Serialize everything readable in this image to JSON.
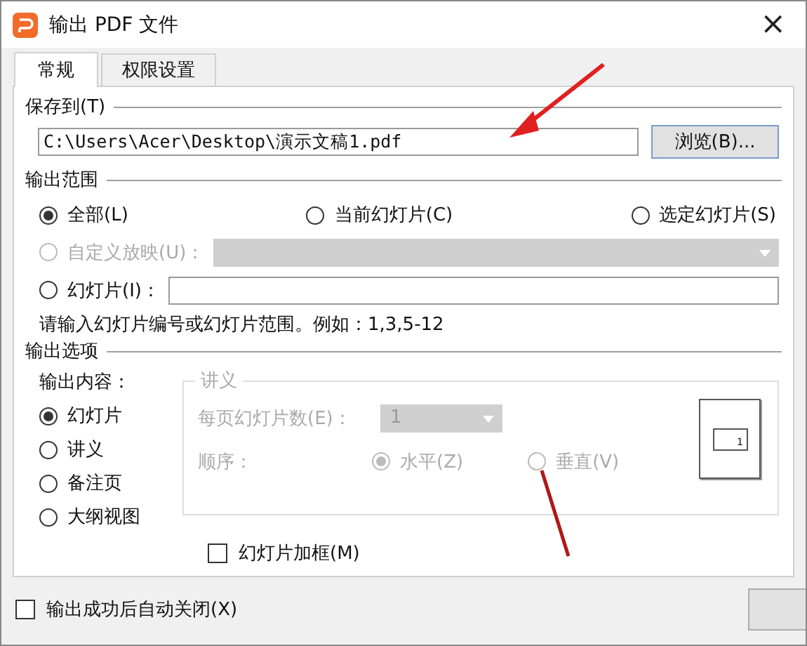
{
  "window": {
    "title": "输出 PDF 文件",
    "close": "×"
  },
  "tabs": [
    {
      "label": "常规",
      "selected": true
    },
    {
      "label": "权限设置",
      "selected": false
    }
  ],
  "save_to": {
    "heading": "保存到(T)",
    "path": "C:\\Users\\Acer\\Desktop\\演示文稿1.pdf",
    "browse_button": "浏览(B)..."
  },
  "output_range": {
    "heading": "输出范围",
    "options": [
      {
        "label": "全部(L)",
        "selected": true
      },
      {
        "label": "当前幻灯片(C)",
        "selected": false
      },
      {
        "label": "选定幻灯片(S)",
        "selected": false
      }
    ],
    "rows": [
      {
        "kind": "combo",
        "label": "自定义放映(U)：",
        "selected": false,
        "disabled": true
      },
      {
        "kind": "field",
        "label": "幻灯片(I)：",
        "selected": false,
        "disabled": false
      }
    ],
    "hint": "请输入幻灯片编号或幻灯片范围。例如：1,3,5-12"
  },
  "output_options": {
    "heading": "输出选项",
    "content_label": "输出内容：",
    "contents": [
      {
        "label": "幻灯片",
        "selected": true
      },
      {
        "label": "讲义",
        "selected": false
      },
      {
        "label": "备注页",
        "selected": false
      },
      {
        "label": "大纲视图",
        "selected": false
      }
    ],
    "handout": {
      "title": "讲义",
      "disabled": true,
      "per_page_label": "每页幻灯片数(E)：",
      "per_page_value": "1",
      "order_label": "顺序：",
      "orders": [
        {
          "label": "水平(Z)",
          "selected": true
        },
        {
          "label": "垂直(V)",
          "selected": false
        }
      ],
      "preview_number": "1"
    },
    "frame_checkbox": {
      "label": "幻灯片加框(M)",
      "checked": false
    }
  },
  "auto_close": {
    "label": "输出成功后自动关闭(X)",
    "checked": false
  }
}
